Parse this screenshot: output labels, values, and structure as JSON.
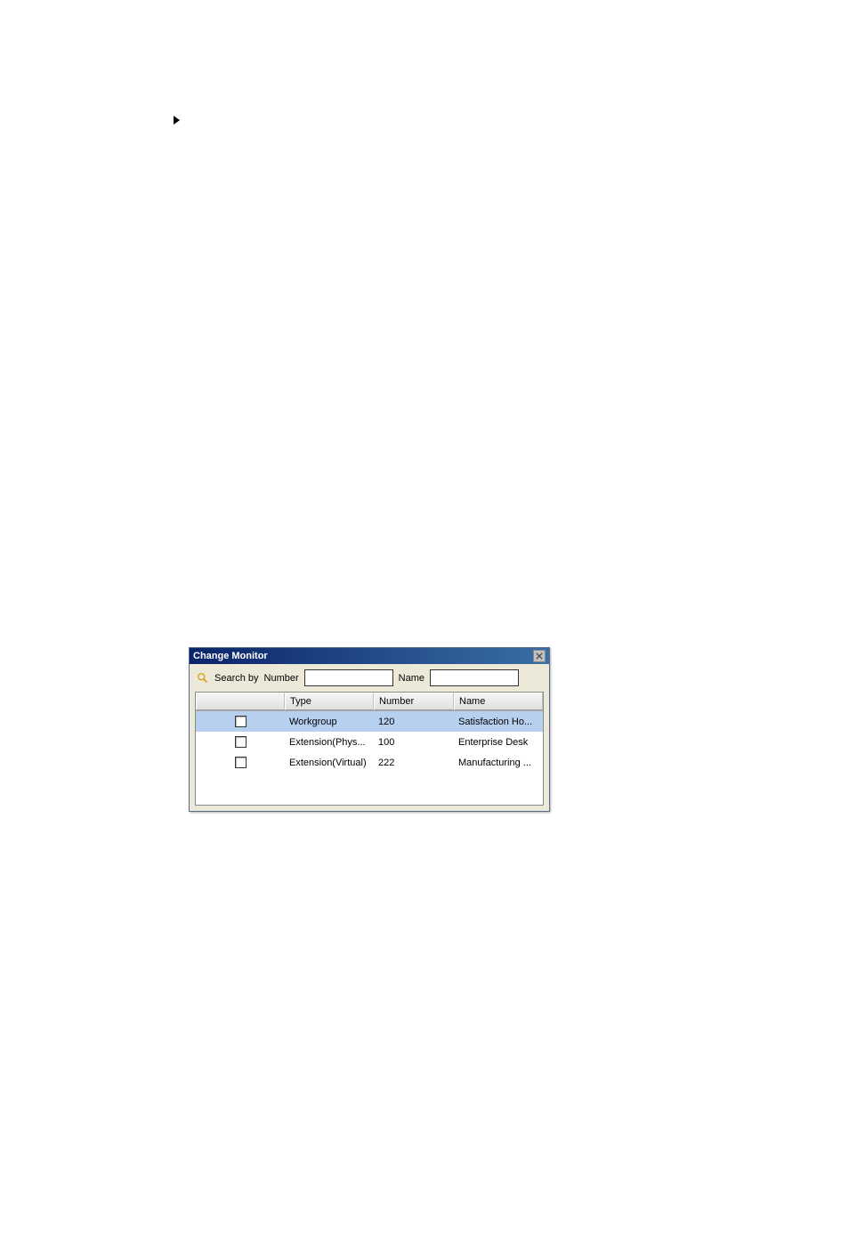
{
  "arrow": "▶",
  "dialog": {
    "title": "Change Monitor",
    "search": {
      "label": "Search by",
      "numberLabel": "Number",
      "numberValue": "",
      "nameLabel": "Name",
      "nameValue": ""
    },
    "table": {
      "headers": {
        "check": "",
        "type": "Type",
        "number": "Number",
        "name": "Name"
      },
      "rows": [
        {
          "selected": true,
          "type": "Workgroup",
          "number": "120",
          "name": "Satisfaction Ho..."
        },
        {
          "selected": false,
          "type": "Extension(Phys...",
          "number": "100",
          "name": "Enterprise Desk"
        },
        {
          "selected": false,
          "type": "Extension(Virtual)",
          "number": "222",
          "name": "Manufacturing ..."
        }
      ]
    }
  }
}
